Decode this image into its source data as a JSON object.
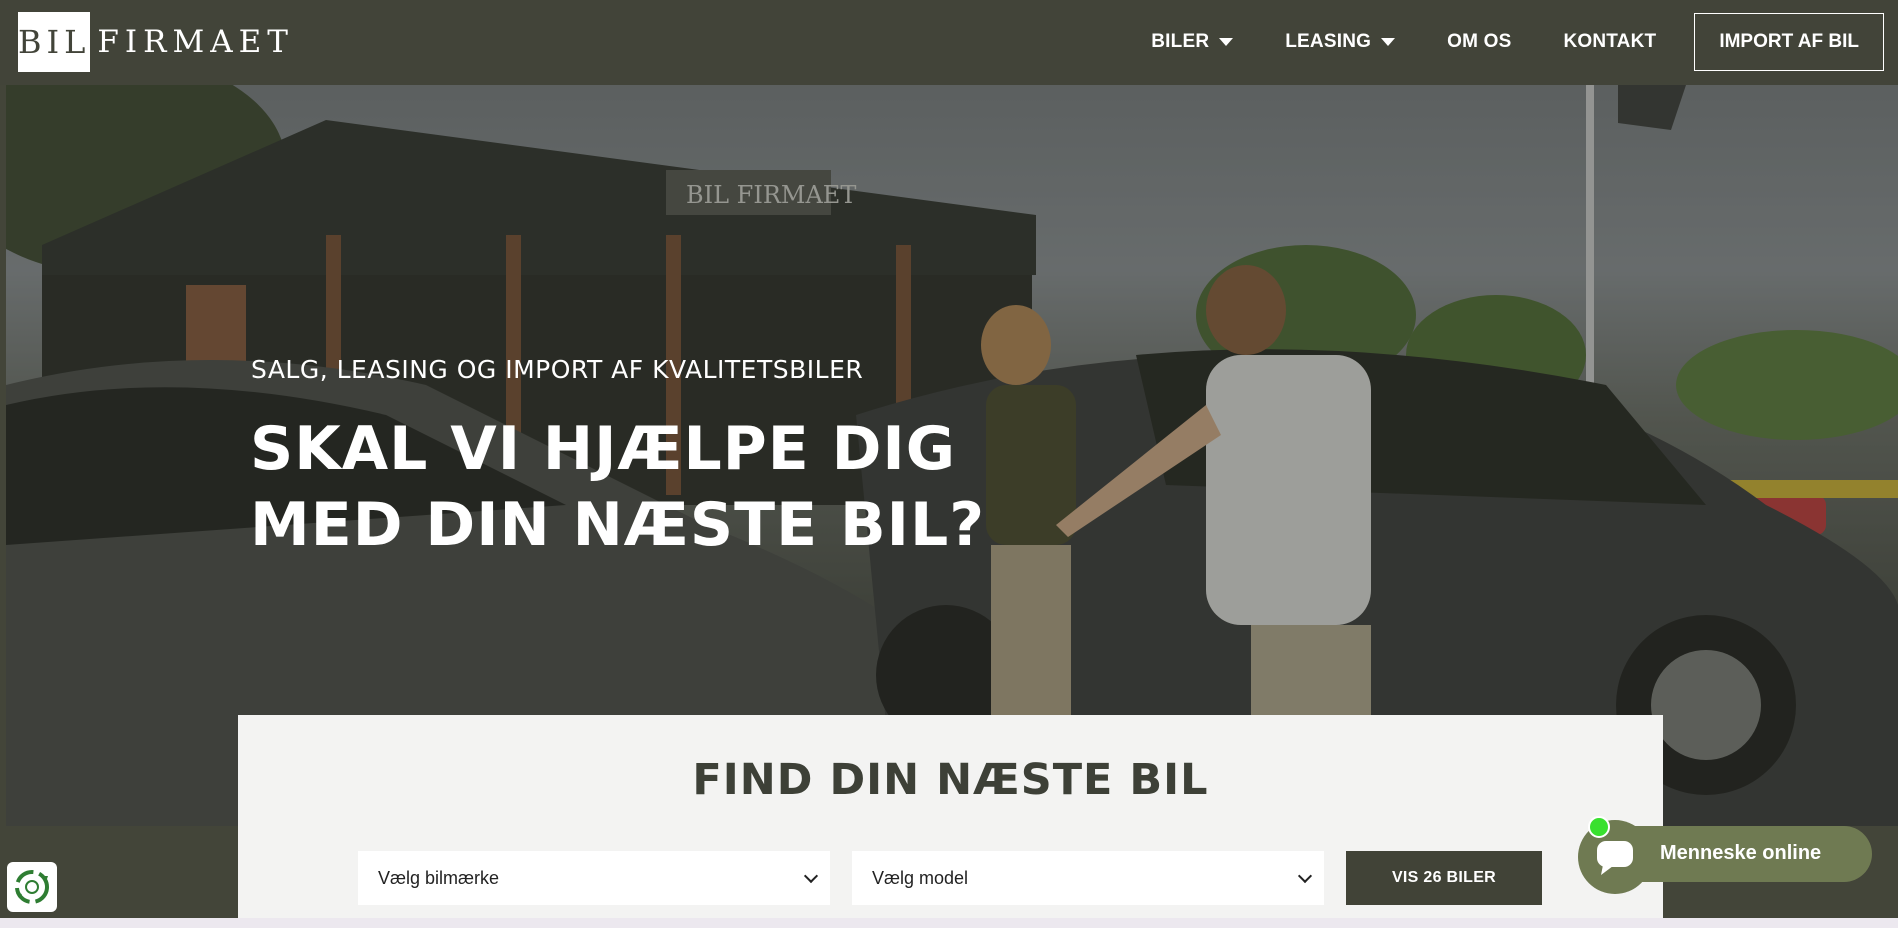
{
  "brand": {
    "logo_box_text": "BIL",
    "logo_word": "FIRMAET"
  },
  "nav": {
    "items": [
      {
        "label": "BILER",
        "has_dropdown": true
      },
      {
        "label": "LEASING",
        "has_dropdown": true
      },
      {
        "label": "OM OS",
        "has_dropdown": false
      },
      {
        "label": "KONTAKT",
        "has_dropdown": false
      }
    ],
    "cta_label": "IMPORT AF BIL"
  },
  "hero": {
    "eyebrow": "SALG, LEASING OG IMPORT AF KVALITETSBILER",
    "title_line1": "SKAL VI HJÆLPE DIG",
    "title_line2": "MED DIN NÆSTE BIL?",
    "sign_text": "BIL FIRMAET"
  },
  "search": {
    "title": "FIND DIN NÆSTE BIL",
    "brand_select": "Vælg bilmærke",
    "model_select": "Vælg model",
    "button_label": "VIS 26 BILER"
  },
  "chat": {
    "label": "Menneske online",
    "status": "online"
  },
  "colors": {
    "header_bg": "#424439",
    "panel_bg": "#f3f3f2",
    "button_bg": "#414337",
    "chat_bg": "#6f7a52",
    "online_dot": "#39e02f"
  },
  "icons": {
    "dropdown": "chevron-down-icon",
    "chat": "chat-bubble-icon",
    "cookie": "recycle-icon"
  }
}
